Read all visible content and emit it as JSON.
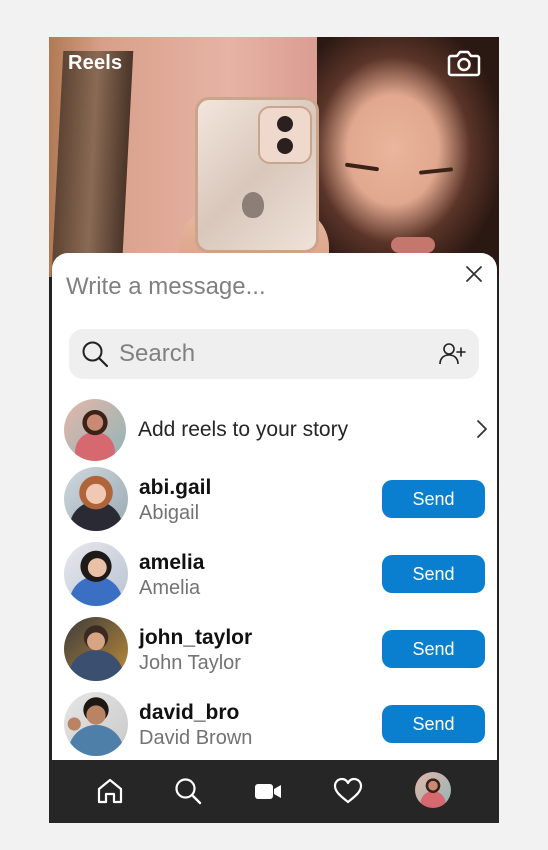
{
  "header": {
    "title": "Reels",
    "camera_icon": "camera-icon"
  },
  "share_sheet": {
    "message_placeholder": "Write a message...",
    "search_placeholder": "Search",
    "story_label": "Add reels to your story",
    "send_label": "Send",
    "users": [
      {
        "username": "abi.gail",
        "fullname": "Abigail"
      },
      {
        "username": "amelia",
        "fullname": "Amelia"
      },
      {
        "username": "john_taylor",
        "fullname": "John Taylor"
      },
      {
        "username": "david_bro",
        "fullname": "David Brown"
      }
    ]
  },
  "bottom_nav": {
    "items": [
      "home-icon",
      "search-icon",
      "reels-video-icon",
      "heart-icon",
      "profile-avatar"
    ]
  },
  "colors": {
    "accent": "#0a7ecf",
    "nav_bg": "#262626",
    "search_bg": "#efefef"
  }
}
